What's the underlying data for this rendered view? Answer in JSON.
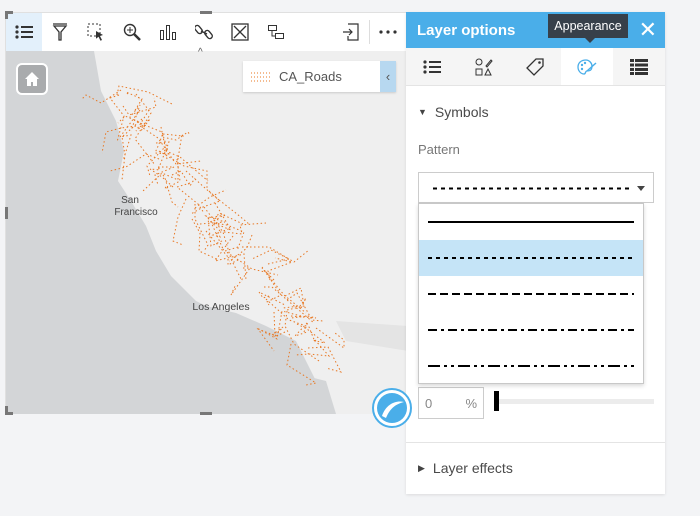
{
  "toolbar": {
    "items": [
      "legend",
      "filter",
      "select",
      "zoom-to",
      "chart",
      "link",
      "expand",
      "swap",
      "export",
      "more"
    ]
  },
  "map": {
    "labels": {
      "sf": "San\nFrancisco",
      "sf1": "San",
      "sf2": "Francisco",
      "la": "Los Angeles"
    },
    "legend": {
      "layer_name": "CA_Roads"
    },
    "road_color": "#e87722"
  },
  "panel": {
    "title": "Layer options",
    "tooltip": "Appearance",
    "tabs": [
      "legend",
      "style",
      "labels",
      "appearance",
      "attributes"
    ],
    "symbols_label": "Symbols",
    "pattern_label": "Pattern",
    "pattern_selected": "dotted",
    "pattern_options": [
      "solid",
      "dotted",
      "dashed",
      "dash-dot",
      "dash-dot-dot"
    ],
    "transparency_value": "0",
    "transparency_unit": "%",
    "transparency_fraction": 0,
    "layer_effects_label": "Layer effects"
  },
  "colors": {
    "accent": "#4aaee9",
    "tooltip": "#37404a",
    "selected_option": "#c5e4f7"
  }
}
